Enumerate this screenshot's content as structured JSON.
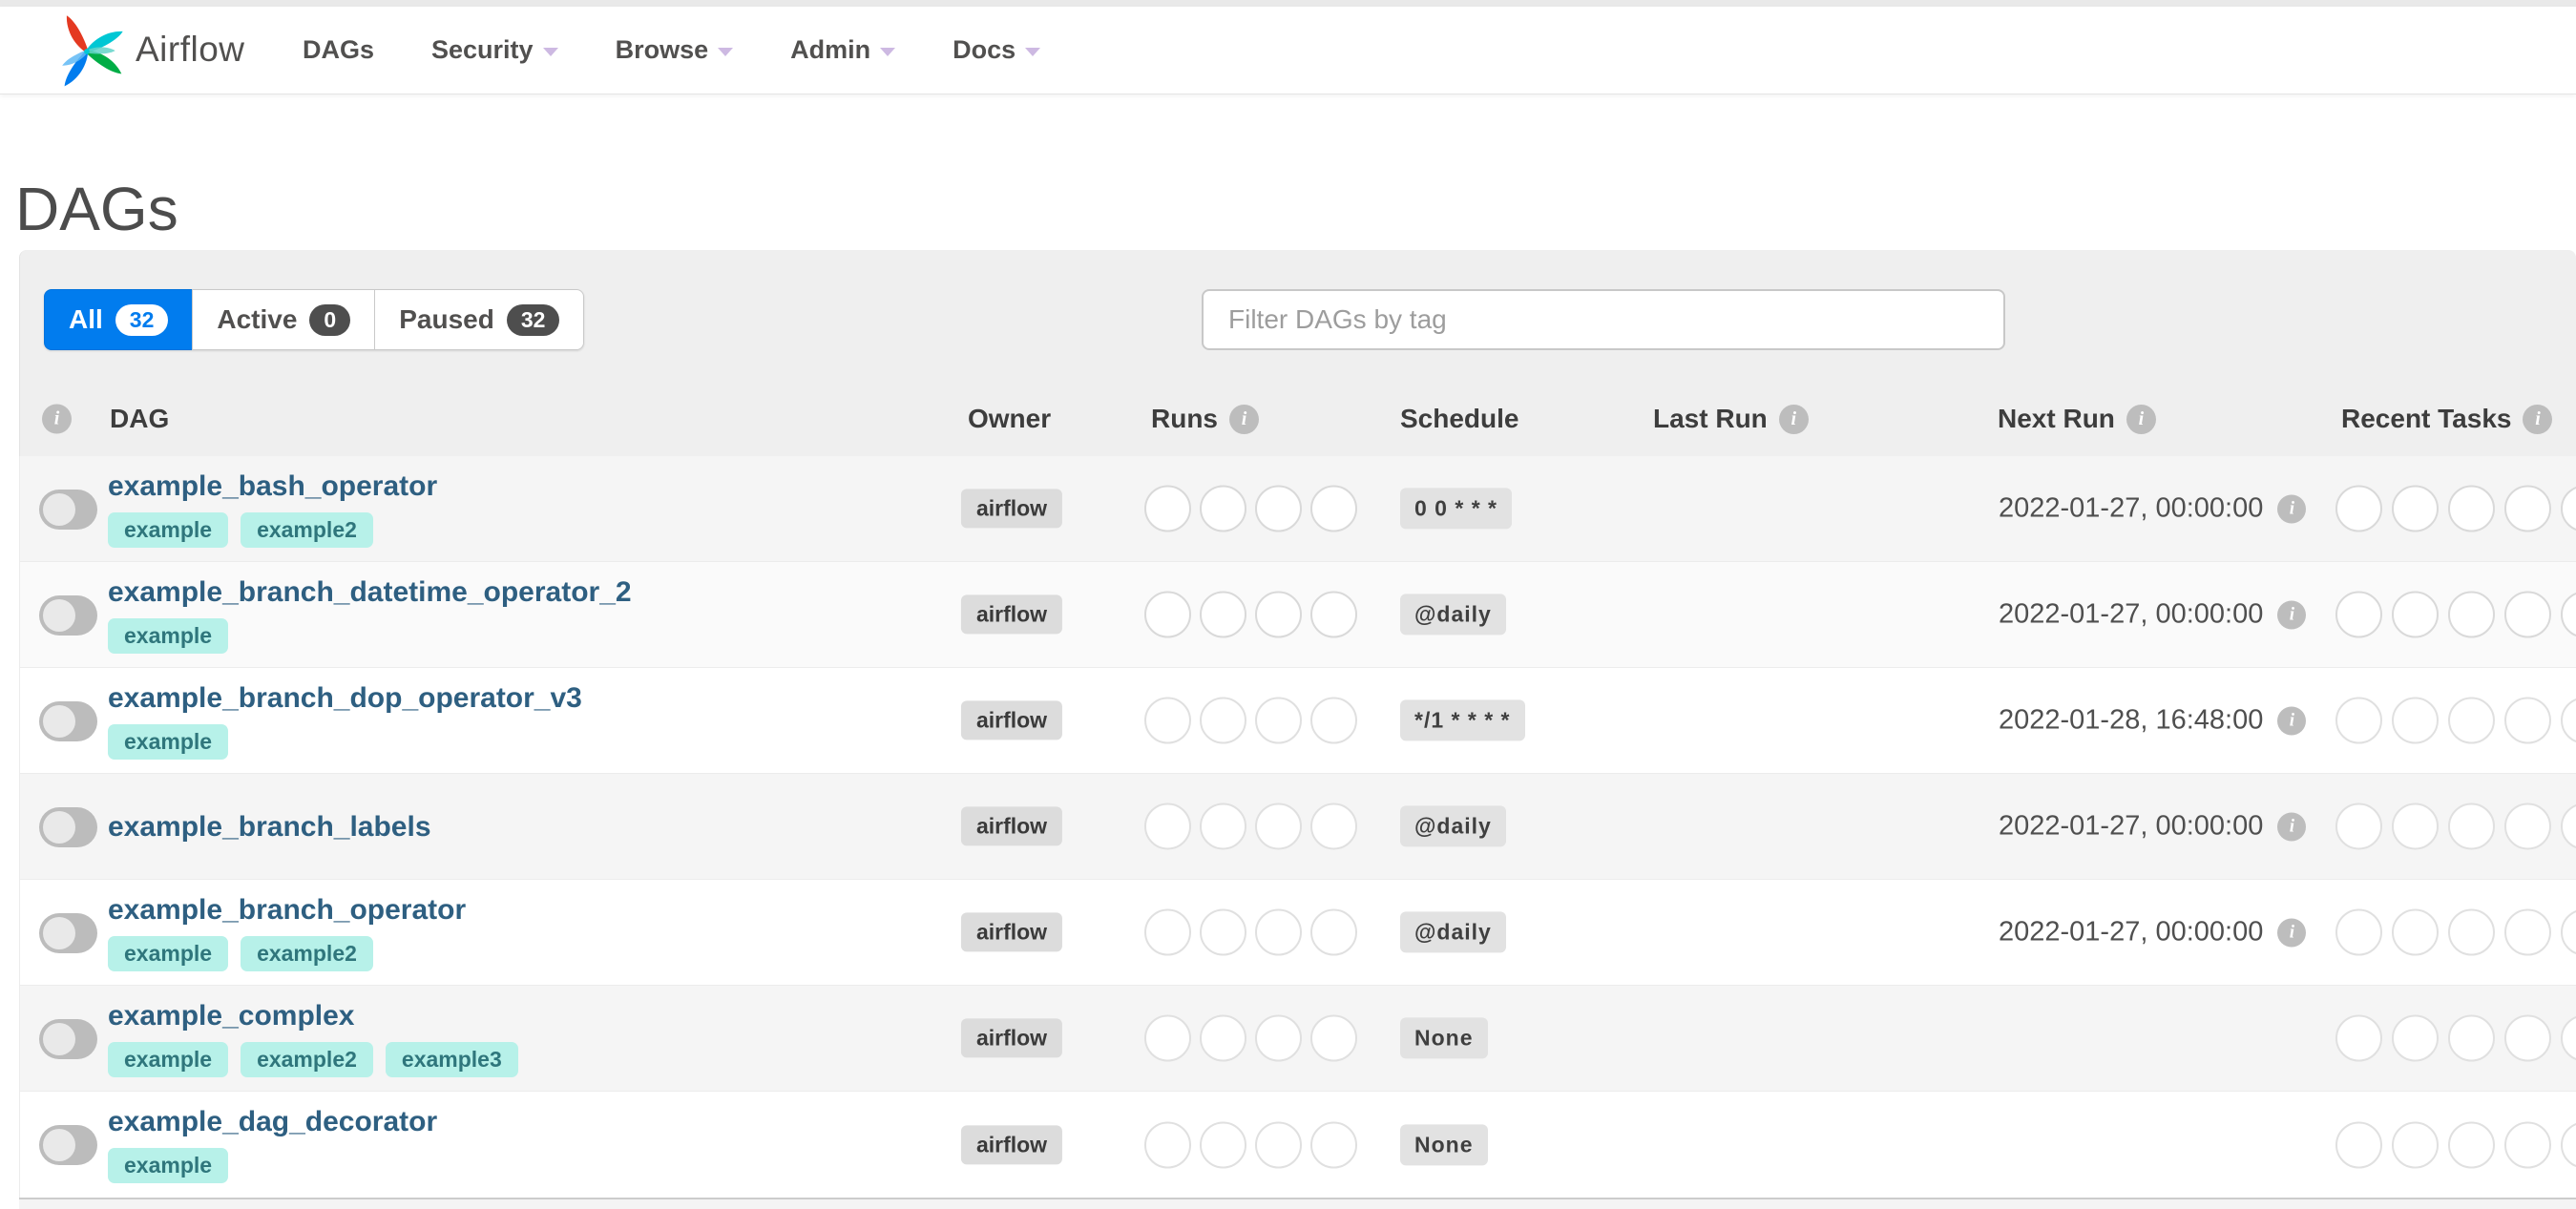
{
  "navbar": {
    "brand": "Airflow",
    "items": [
      {
        "label": "DAGs",
        "caret": false
      },
      {
        "label": "Security",
        "caret": true
      },
      {
        "label": "Browse",
        "caret": true
      },
      {
        "label": "Admin",
        "caret": true
      },
      {
        "label": "Docs",
        "caret": true
      }
    ]
  },
  "page_title": "DAGs",
  "filters": {
    "tabs": [
      {
        "label": "All",
        "count": "32",
        "active": true
      },
      {
        "label": "Active",
        "count": "0",
        "active": false
      },
      {
        "label": "Paused",
        "count": "32",
        "active": false
      }
    ],
    "tag_filter_placeholder": "Filter DAGs by tag"
  },
  "table": {
    "columns": [
      {
        "key": "dag",
        "label": "DAG",
        "info_after": false
      },
      {
        "key": "owner",
        "label": "Owner",
        "info_after": false
      },
      {
        "key": "runs",
        "label": "Runs",
        "info_after": true
      },
      {
        "key": "schedule",
        "label": "Schedule",
        "info_after": false
      },
      {
        "key": "lastrun",
        "label": "Last Run",
        "info_after": true
      },
      {
        "key": "nextrun",
        "label": "Next Run",
        "info_after": true
      },
      {
        "key": "recent",
        "label": "Recent Tasks",
        "info_after": true
      }
    ],
    "rows": [
      {
        "name": "example_bash_operator",
        "tags": [
          "example",
          "example2"
        ],
        "owner": "airflow",
        "paused": true,
        "runs_slots": 4,
        "schedule": "0 0 * * *",
        "last_run": "",
        "next_run": "2022-01-27, 00:00:00",
        "next_run_info": true,
        "recent_task_slots": 5
      },
      {
        "name": "example_branch_datetime_operator_2",
        "tags": [
          "example"
        ],
        "owner": "airflow",
        "paused": true,
        "runs_slots": 4,
        "schedule": "@daily",
        "last_run": "",
        "next_run": "2022-01-27, 00:00:00",
        "next_run_info": true,
        "recent_task_slots": 5
      },
      {
        "name": "example_branch_dop_operator_v3",
        "tags": [
          "example"
        ],
        "owner": "airflow",
        "paused": true,
        "runs_slots": 4,
        "schedule": "*/1 * * * *",
        "last_run": "",
        "next_run": "2022-01-28, 16:48:00",
        "next_run_info": true,
        "recent_task_slots": 5
      },
      {
        "name": "example_branch_labels",
        "tags": [],
        "owner": "airflow",
        "paused": true,
        "runs_slots": 4,
        "schedule": "@daily",
        "last_run": "",
        "next_run": "2022-01-27, 00:00:00",
        "next_run_info": true,
        "recent_task_slots": 5
      },
      {
        "name": "example_branch_operator",
        "tags": [
          "example",
          "example2"
        ],
        "owner": "airflow",
        "paused": true,
        "runs_slots": 4,
        "schedule": "@daily",
        "last_run": "",
        "next_run": "2022-01-27, 00:00:00",
        "next_run_info": true,
        "recent_task_slots": 5
      },
      {
        "name": "example_complex",
        "tags": [
          "example",
          "example2",
          "example3"
        ],
        "owner": "airflow",
        "paused": true,
        "runs_slots": 4,
        "schedule": "None",
        "last_run": "",
        "next_run": "",
        "next_run_info": false,
        "recent_task_slots": 5
      },
      {
        "name": "example_dag_decorator",
        "tags": [
          "example"
        ],
        "owner": "airflow",
        "paused": true,
        "runs_slots": 4,
        "schedule": "None",
        "last_run": "",
        "next_run": "",
        "next_run_info": false,
        "recent_task_slots": 5
      }
    ]
  },
  "colors": {
    "accent_blue": "#017cee",
    "dag_link": "#2e5f81",
    "tag_bg": "#b7f1e9",
    "tag_text": "#2f767c",
    "badge_gray_bg": "#e2e2e2",
    "owner_badge_bg": "#dcdcdc",
    "count_badge_dark": "#4e4e4e",
    "logo_red": "#e43921",
    "logo_cyan": "#00c7d4",
    "logo_green": "#00ad46",
    "logo_blue": "#017cee"
  }
}
